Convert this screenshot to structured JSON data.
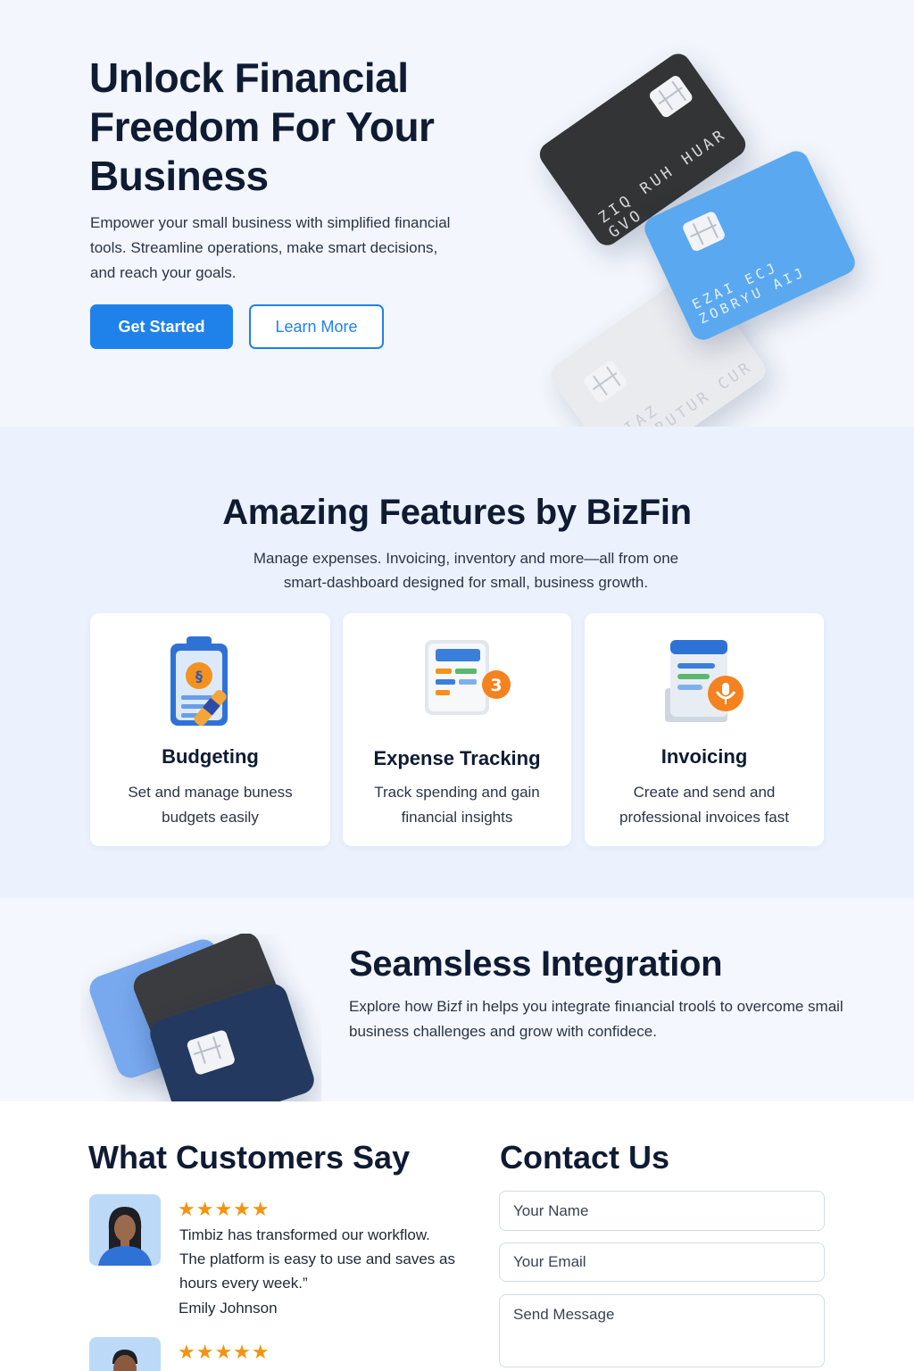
{
  "hero": {
    "title": "Unlock Financial Freedom For Your Business",
    "subtitle": "Empower your small business with simplified financial tools. Streamline operations, make smart decisions, and reach your goals.",
    "primary_button": "Get Started",
    "secondary_button": "Learn More",
    "card_dark_text": "ZIQ RUH HUAR GVO",
    "card_blue_text": "EZAI ECJ ZOBRYU AIJ",
    "card_gray_text": "OIAZ RUHRUTUR CUR"
  },
  "features": {
    "title": "Amazing Features by BizFin",
    "subtitle": "Manage expenses. Invoicing, inventory and more—all from one smart-dashboard designed for small, business growth.",
    "cards": [
      {
        "title": "Budgeting",
        "description": "Set and manage buness budgets easily",
        "icon": "clipboard-icon"
      },
      {
        "title": "Expense Tracking",
        "description": "Track spending and gain financial insights",
        "icon": "receipt-icon",
        "badge": "3"
      },
      {
        "title": "Invoicing",
        "description": "Create and send and professional invoices fast",
        "icon": "invoice-icon"
      }
    ]
  },
  "integration": {
    "title": "Seamsless Integration",
    "subtitle": "Explore how Bizf in helps you integrate finıancial troolś to overcome smail business challenges and grow with confidece."
  },
  "testimonials": {
    "title": "What Customers Say",
    "items": [
      {
        "stars": "★★★★★",
        "quote": "Timbiz has transformed our workflow. The platform is easy to use and saves as hours every week.”",
        "author": "Emily Johnson"
      },
      {
        "stars": "★★★★★"
      }
    ]
  },
  "contact": {
    "title": "Contact Us",
    "name_placeholder": "Your Name",
    "email_placeholder": "Your Email",
    "message_placeholder": "Send Message"
  },
  "colors": {
    "accent": "#1f82ea",
    "heading": "#0f1b33",
    "star": "#f39312",
    "features_bg": "#ebf2fd"
  }
}
